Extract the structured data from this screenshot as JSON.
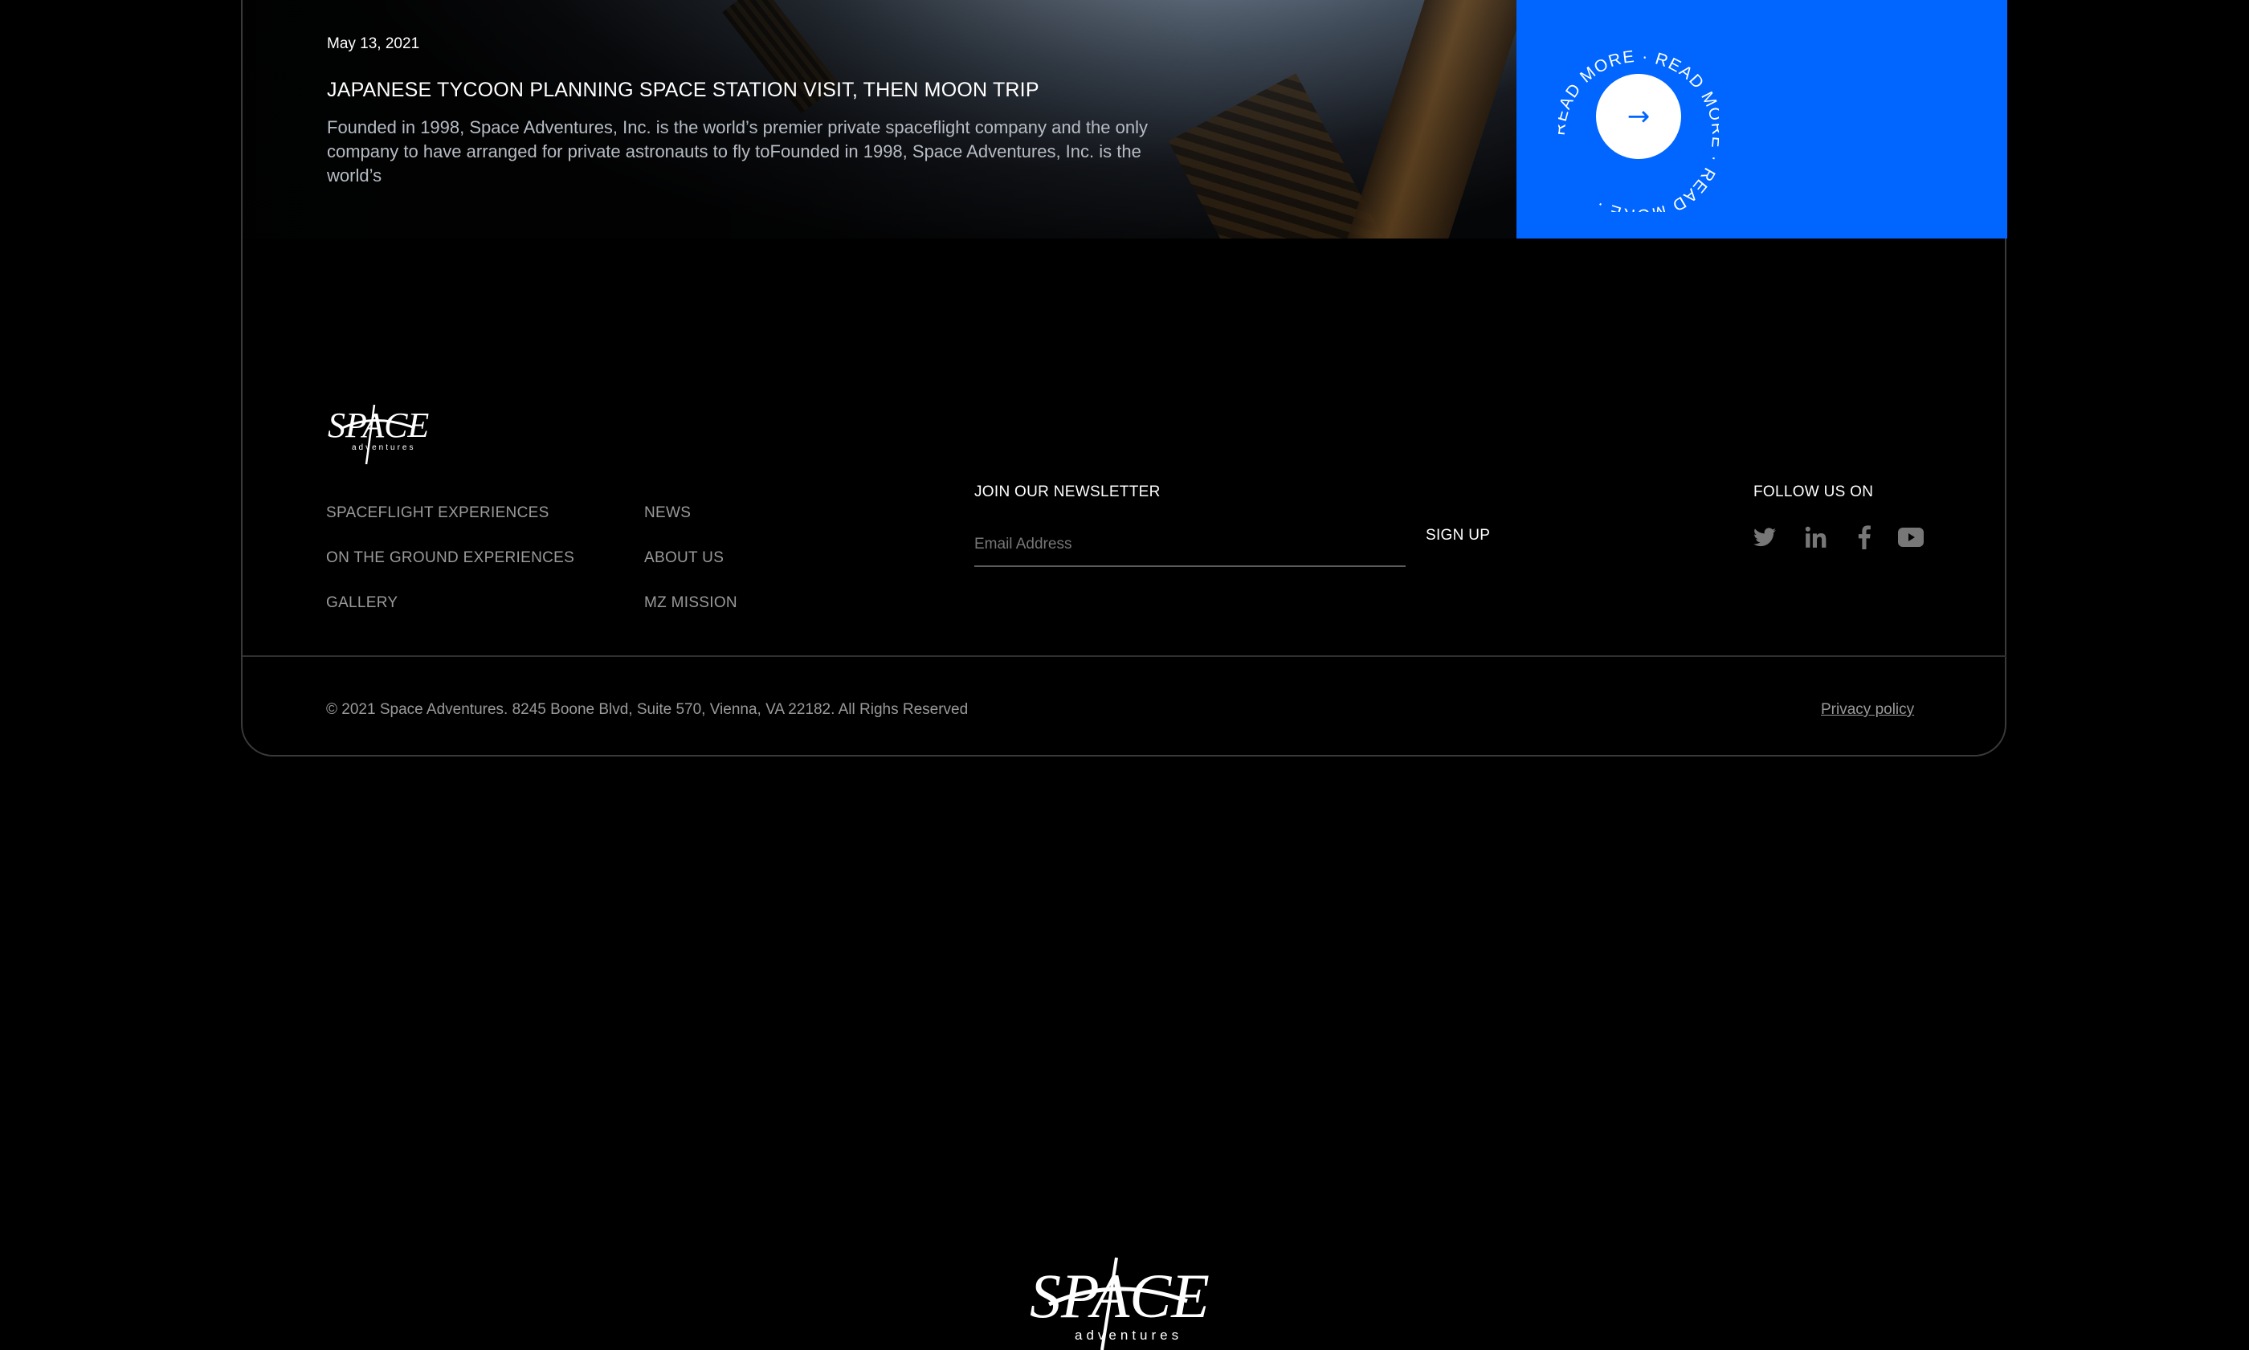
{
  "article": {
    "date": "May 13, 2021",
    "title": "JAPANESE TYCOON PLANNING SPACE STATION VISIT, THEN MOON TRIP",
    "excerpt": "Founded in 1998, Space Adventures, Inc. is the world’s premier private spaceflight company and the only company to have arranged for private astronauts to fly toFounded in 1998, Space Adventures, Inc. is the world’s",
    "read_more_text": "READ MORE · READ MORE · READ MORE · ",
    "read_more_arrow": "→"
  },
  "brand": {
    "logo_text": "SPACE",
    "logo_subtext": "adventures"
  },
  "footer": {
    "nav_col1": [
      "SPACEFLIGHT EXPERIENCES",
      "ON THE GROUND EXPERIENCES",
      "GALLERY"
    ],
    "nav_col2": [
      "NEWS",
      "ABOUT US",
      "MZ MISSION"
    ],
    "newsletter_label": "JOIN OUR NEWSLETTER",
    "email_placeholder": "Email Address",
    "signup_label": "SIGN UP",
    "follow_label": "FOLLOW US ON",
    "social_icons": [
      "twitter-icon",
      "linkedin-icon",
      "facebook-icon",
      "youtube-icon"
    ],
    "copyright": "© 2021 Space Adventures. 8245 Boone Blvd, Suite 570, Vienna, VA 22182. All Righs Reserved",
    "privacy_label": "Privacy policy"
  },
  "colors": {
    "accent": "#0066ff",
    "background": "#000000",
    "muted_text": "#9a9a9a",
    "icon_gray": "#777777"
  }
}
